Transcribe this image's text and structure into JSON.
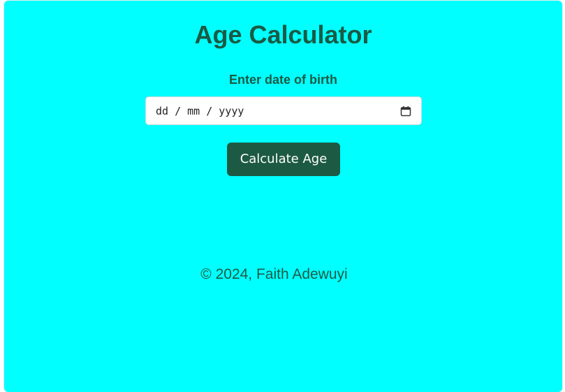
{
  "app": {
    "title": "Age Calculator"
  },
  "form": {
    "label": "Enter date of birth",
    "date_input": {
      "placeholder": "dd / mm / yyyy",
      "value": ""
    },
    "calendar_icon": "calendar-icon",
    "button_label": "Calculate Age"
  },
  "footer": {
    "text": "© 2024, Faith Adewuyi"
  },
  "colors": {
    "background": "#00ffff",
    "accent": "#1d5a44",
    "text": "#1b5a44"
  }
}
